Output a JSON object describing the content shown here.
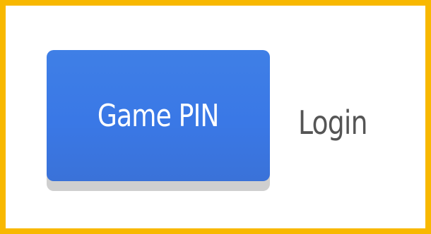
{
  "colors": {
    "frame_border": "#f8b800",
    "primary_button": "#3a78e6",
    "button_shadow": "#cfcfcf",
    "login_text": "#555555",
    "background": "#ffffff"
  },
  "actions": {
    "game_pin_label": "Game PIN",
    "login_label": "Login"
  }
}
